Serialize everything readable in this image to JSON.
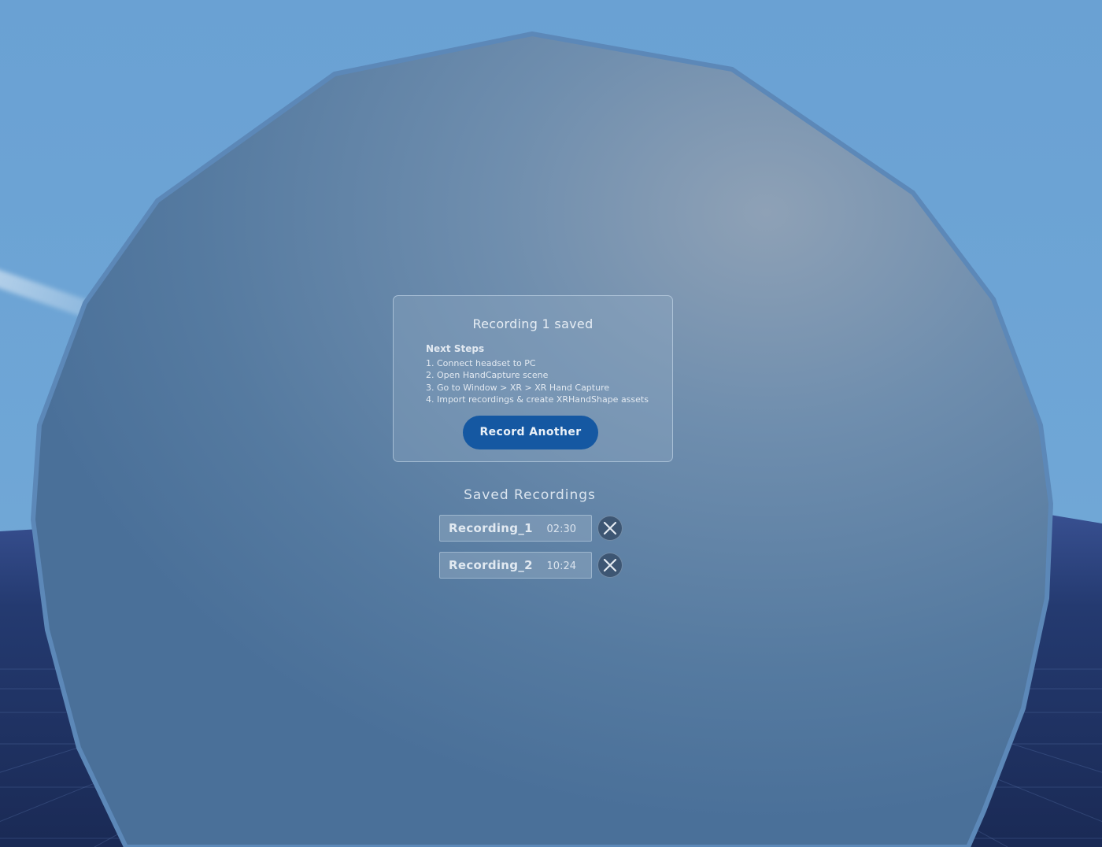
{
  "dialog": {
    "title": "Recording 1 saved",
    "steps_heading": "Next Steps",
    "steps": [
      "1. Connect headset to PC",
      "2. Open HandCapture scene",
      "3. Go to Window > XR > XR Hand Capture",
      "4. Import recordings & create XRHandShape assets"
    ],
    "button_label": "Record Another",
    "button_color": "#1558a2"
  },
  "saved": {
    "title": "Saved Recordings",
    "items": [
      {
        "name": "Recording_1",
        "duration": "02:30",
        "delete_icon": "close-icon"
      },
      {
        "name": "Recording_2",
        "duration": "10:24",
        "delete_icon": "close-icon"
      }
    ]
  },
  "colors": {
    "sky": "#6fa6d6",
    "sphere": "#557aa0",
    "floor": "#1e2f5e"
  }
}
